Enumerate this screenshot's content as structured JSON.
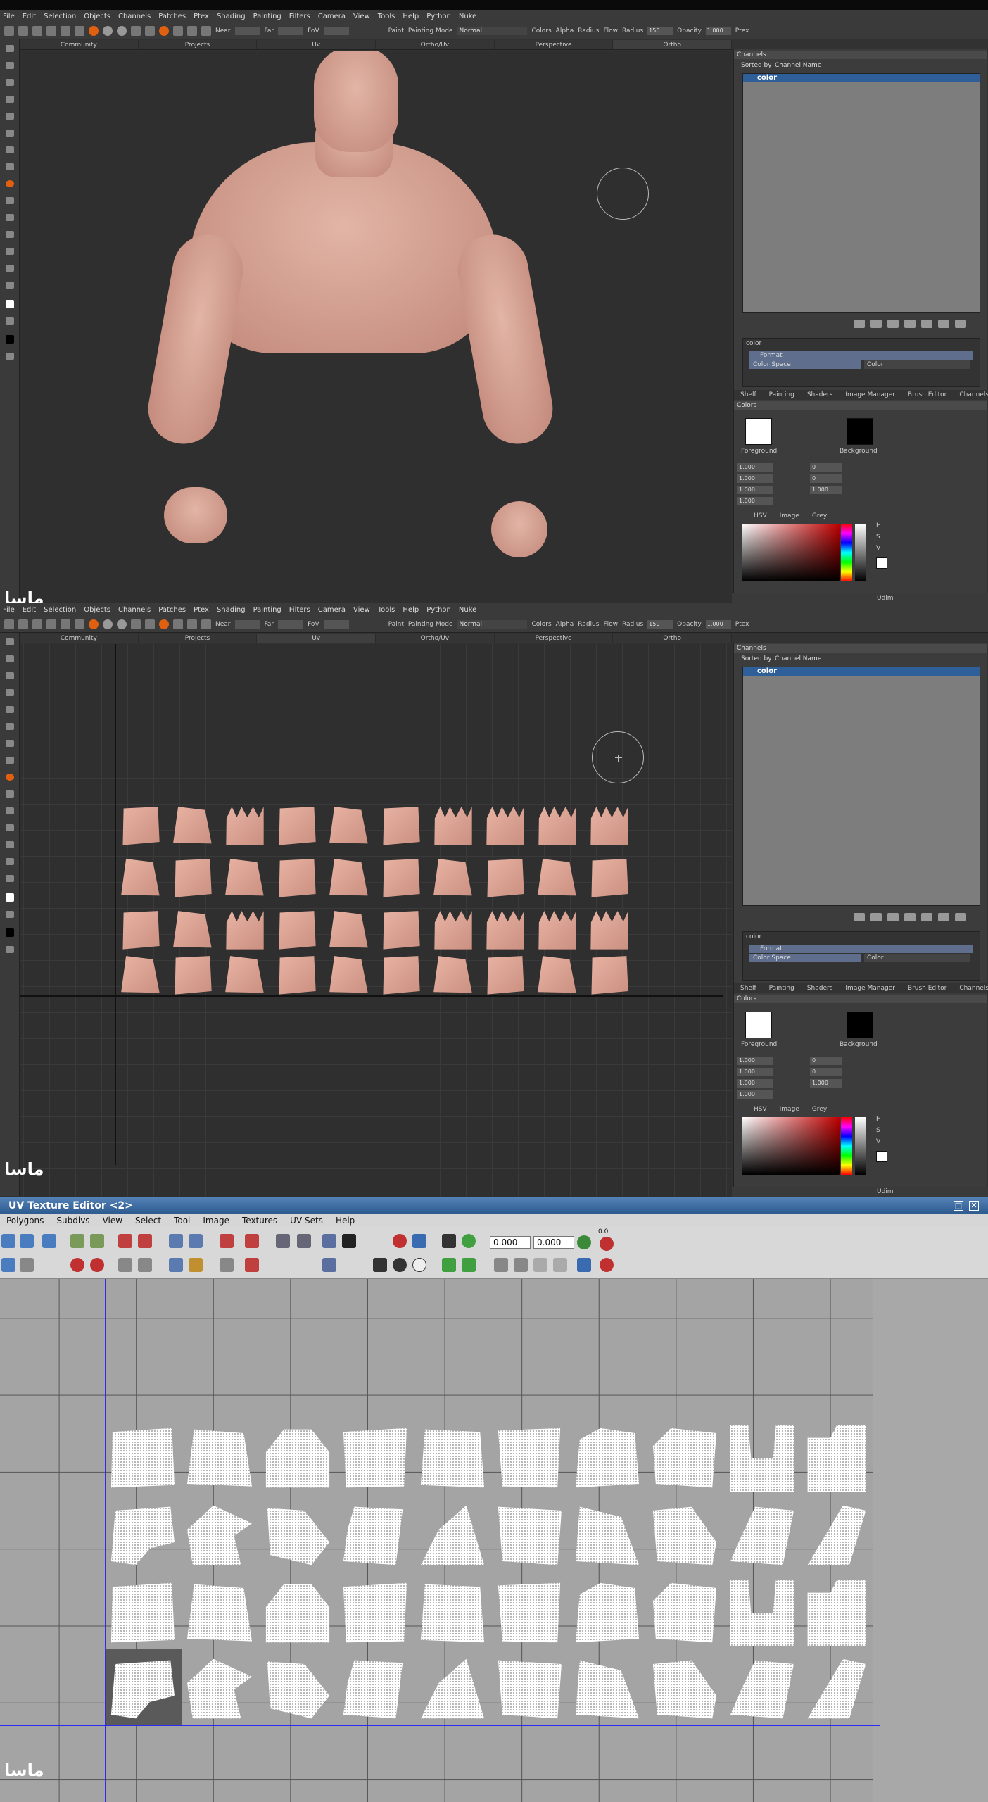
{
  "menu": [
    "File",
    "Edit",
    "Selection",
    "Objects",
    "Channels",
    "Patches",
    "Ptex",
    "Shading",
    "Painting",
    "Filters",
    "Camera",
    "View",
    "Tools",
    "Help",
    "Python",
    "Nuke"
  ],
  "toolbar": {
    "near_label": "Near",
    "far_label": "Far",
    "fov_label": "FoV",
    "paint_label": "Paint",
    "painting_mode_label": "Painting Mode",
    "painting_mode_value": "Normal",
    "colors_label": "Colors",
    "alpha_label": "Alpha",
    "radius_label": "Radius",
    "flow_label": "Flow",
    "radius2_label": "Radius",
    "radius_value": "150",
    "opacity_label": "Opacity",
    "opacity_value": "1.000",
    "ptex_label": "Ptex"
  },
  "tabs": [
    "Community",
    "Projects",
    "Uv",
    "Ortho/Uv",
    "Perspective",
    "Ortho"
  ],
  "channels": {
    "title": "Channels",
    "sorted_by": "Sorted by",
    "sort_value": "Channel Name",
    "selected": "color"
  },
  "attributes": {
    "name": "color",
    "format": "Format",
    "color_space_label": "Color Space",
    "color_space_value": "Color"
  },
  "panel_tabs": [
    "Shelf",
    "Painting",
    "Shaders",
    "Image Manager",
    "Brush Editor",
    "Channels"
  ],
  "colors_panel": {
    "title": "Colors",
    "foreground": "Foreground",
    "background": "Background",
    "values": [
      "1.000",
      "1.000",
      "1.000",
      "1.000"
    ],
    "small_values": [
      "0",
      "0",
      "1.000"
    ],
    "tabs": [
      "HSV",
      "Image",
      "Grey"
    ],
    "hsv": [
      "H",
      "S",
      "V"
    ]
  },
  "status": "Udim",
  "watermark": "ماسا",
  "uv_editor": {
    "title": "UV Texture Editor <2>",
    "menu": [
      "Polygons",
      "Subdivs",
      "View",
      "Select",
      "Tool",
      "Image",
      "Textures",
      "UV Sets",
      "Help"
    ],
    "u_value": "0.000",
    "v_value": "0.000",
    "small_label": "0.0"
  },
  "colors": {
    "accent": "#e06010",
    "selection": "#2f5f99",
    "title_bar": "#3d6da3"
  }
}
